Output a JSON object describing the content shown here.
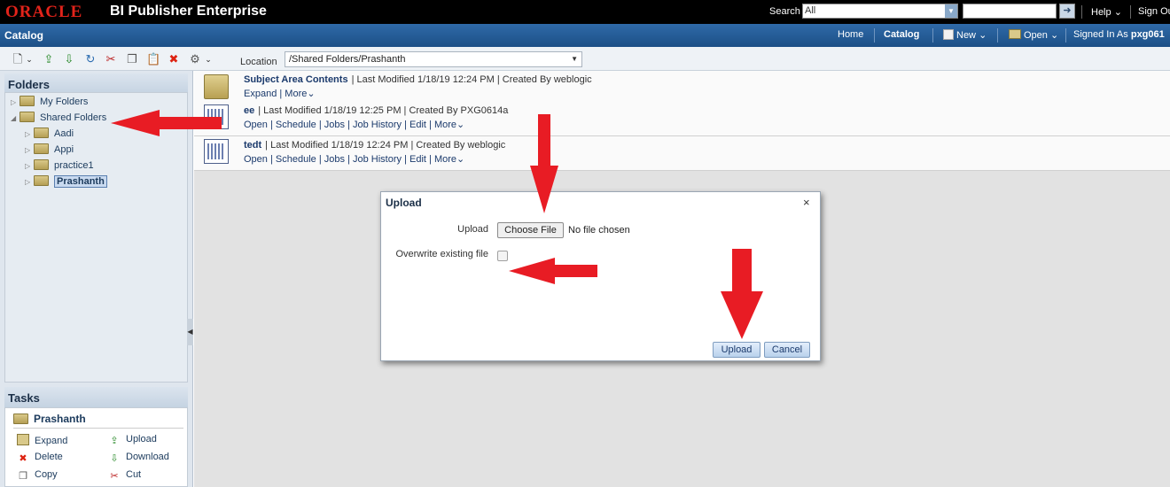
{
  "header": {
    "logo": "ORACLE",
    "product": "BI Publisher Enterprise",
    "search_label": "Search",
    "search_scope": "All",
    "search_value": "",
    "help": "Help",
    "signout": "Sign Ou"
  },
  "nav": {
    "title": "Catalog",
    "home": "Home",
    "catalog": "Catalog",
    "new": "New",
    "open": "Open",
    "signed_in_label": "Signed In As",
    "user": "pxg061"
  },
  "toolbar": {
    "location_label": "Location",
    "location_value": "/Shared Folders/Prashanth"
  },
  "sidebar": {
    "folders_title": "Folders",
    "tree": [
      {
        "label": "My Folders"
      },
      {
        "label": "Shared Folders"
      },
      {
        "label": "Aadi"
      },
      {
        "label": "Appi"
      },
      {
        "label": "practice1"
      },
      {
        "label": "Prashanth"
      }
    ],
    "tasks_title": "Tasks",
    "tasks_folder": "Prashanth",
    "tasks": {
      "expand": "Expand",
      "upload": "Upload",
      "delete": "Delete",
      "download": "Download",
      "copy": "Copy",
      "cut": "Cut"
    }
  },
  "items": [
    {
      "name": "Subject Area Contents",
      "meta": "| Last Modified 1/18/19 12:24 PM | Created By weblogic",
      "links": [
        "Expand",
        "More"
      ]
    },
    {
      "name": "ee",
      "meta": "| Last Modified 1/18/19 12:25 PM | Created By PXG0614a",
      "links": [
        "Open",
        "Schedule",
        "Jobs",
        "Job History",
        "Edit",
        "More"
      ]
    },
    {
      "name": "tedt",
      "meta": "| Last Modified 1/18/19 12:24 PM | Created By weblogic",
      "links": [
        "Open",
        "Schedule",
        "Jobs",
        "Job History",
        "Edit",
        "More"
      ]
    }
  ],
  "dialog": {
    "title": "Upload",
    "close": "×",
    "upload_label": "Upload",
    "choose_file": "Choose File",
    "no_file": "No file chosen",
    "overwrite_label": "Overwrite existing file",
    "overwrite_checked": false,
    "upload_button": "Upload",
    "cancel_button": "Cancel"
  },
  "colors": {
    "accent_red": "#e81c24",
    "nav_blue": "#1c4f86",
    "oracle_red": "#e2231a"
  }
}
